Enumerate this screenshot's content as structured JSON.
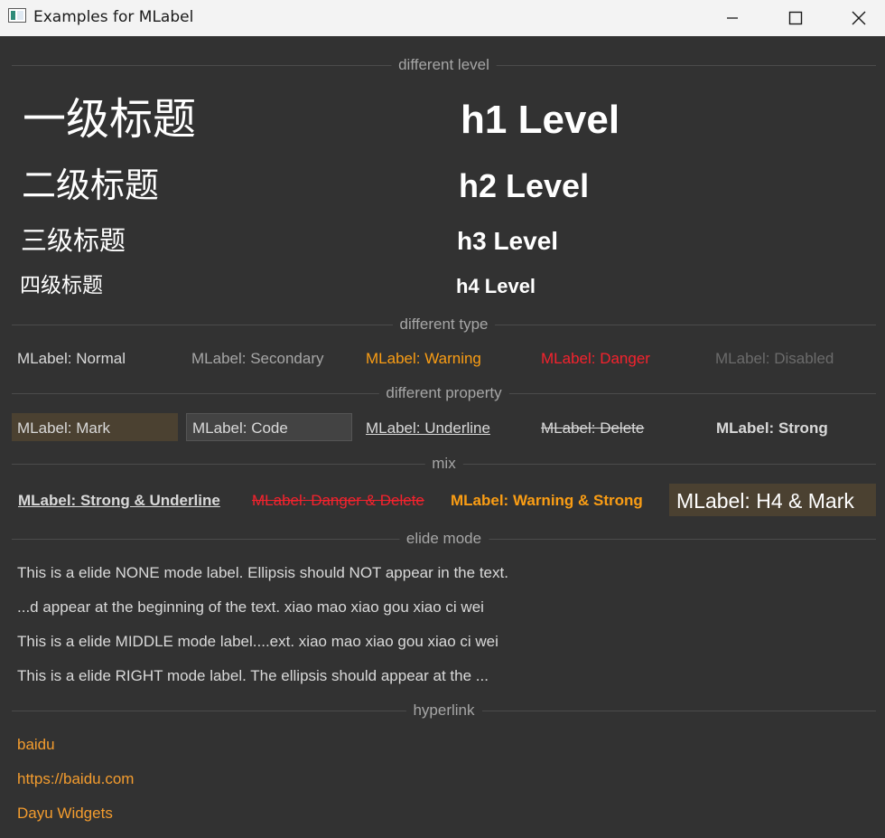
{
  "window": {
    "title": "Examples for MLabel"
  },
  "sections": {
    "level": "different level",
    "type": "different type",
    "property": "different property",
    "mix": "mix",
    "elide": "elide mode",
    "hyperlink": "hyperlink"
  },
  "levels": {
    "cn": [
      "一级标题",
      "二级标题",
      "三级标题",
      "四级标题"
    ],
    "en": [
      "h1 Level",
      "h2 Level",
      "h3 Level",
      "h4 Level"
    ]
  },
  "types": {
    "normal": "MLabel: Normal",
    "secondary": "MLabel: Secondary",
    "warning": "MLabel: Warning",
    "danger": "MLabel: Danger",
    "disabled": "MLabel: Disabled"
  },
  "properties": {
    "mark": "MLabel: Mark",
    "code": "MLabel: Code",
    "underline": "MLabel: Underline",
    "delete": "MLabel: Delete",
    "strong": "MLabel: Strong"
  },
  "mix": {
    "strong_underline": "MLabel: Strong & Underline",
    "danger_delete": "MLabel: Danger & Delete",
    "warning_strong": "MLabel: Warning & Strong",
    "h4_mark": "MLabel: H4 & Mark"
  },
  "elide": {
    "none": "This is a elide NONE mode label. Ellipsis should NOT appear in the text.",
    "left": "...d appear at the beginning of the text. xiao mao xiao gou xiao ci wei",
    "middle": "This is a elide MIDDLE mode label....ext. xiao mao xiao gou xiao ci wei",
    "right": "This is a elide RIGHT mode label. The ellipsis should appear at the ..."
  },
  "hyperlinks": [
    "baidu",
    "https://baidu.com",
    "Dayu Widgets"
  ],
  "colors": {
    "background": "#323232",
    "warning": "#fa9d14",
    "danger": "#f5222d",
    "link": "#f39c2e",
    "mark_bg": "#4b4131"
  }
}
